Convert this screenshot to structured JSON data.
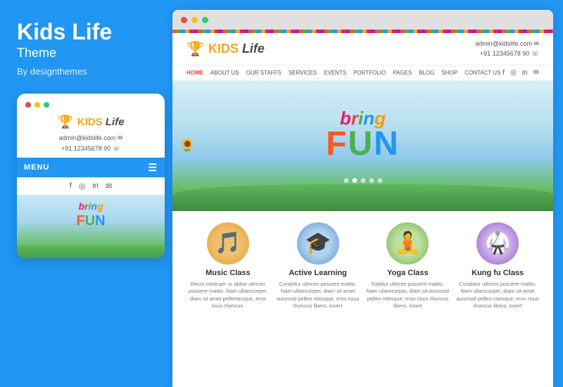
{
  "left": {
    "title": "Kids Life",
    "subtitle": "Theme",
    "author": "By designthemes",
    "dots": [
      "dot-red",
      "dot-yellow",
      "dot-green"
    ],
    "logo": {
      "trophy": "🏆",
      "kids": "KIDS",
      "life": "Life"
    },
    "contact": {
      "email": "admin@kidslife.com",
      "phone": "+91 12345678 90"
    },
    "menu_label": "MENU",
    "social_icons": [
      "f",
      "◎",
      "in",
      "✉"
    ],
    "bring_text": "bring",
    "fun_text": "FUN",
    "bring_letters": [
      "b",
      "r",
      "i",
      "n",
      "g"
    ],
    "fun_letters": [
      "F",
      "U",
      "N"
    ]
  },
  "browser": {
    "dots": [
      {
        "class": "dot-red",
        "color": "#e74c3c"
      },
      {
        "class": "dot-yellow",
        "color": "#f1c40f"
      },
      {
        "class": "dot-green",
        "color": "#2ecc71"
      }
    ],
    "header": {
      "trophy": "🏆",
      "kids": "KIDS",
      "life": "Life",
      "email": "admin@kidslife.com ✉",
      "phone": "+91 12345678 90 ☏"
    },
    "nav": {
      "links": [
        "HOME",
        "ABOUT US",
        "OUR STAFFS",
        "SERVICES",
        "EVENTS",
        "PORTFOLIO",
        "PAGES",
        "BLOG",
        "SHOP",
        "CONTACT US"
      ],
      "active_index": 0
    },
    "hero": {
      "bring": "bring",
      "fun": "FUN",
      "bring_letters": [
        "b",
        "r",
        "i",
        "n",
        "g"
      ],
      "fun_letters": [
        "F",
        "U",
        "N"
      ]
    },
    "classes": [
      {
        "name": "Music Class",
        "emoji": "🎵",
        "desc": "Decor ostdcaer ur abitur ultrices posuere mattis. Nam ullamcorper, diam sit amet pellentesque, eros risus rhoncus.",
        "avatar_class": "avatar-music"
      },
      {
        "name": "Active Learning",
        "emoji": "🎓",
        "desc": "Curabitur ultrices posuere mattis. Nam ullamcorper, diam sit amet auismod pelleo ntiesque, eros risus rhoncus libero, invert",
        "avatar_class": "avatar-learning"
      },
      {
        "name": "Yoga Class",
        "emoji": "🧘",
        "desc": "Rabitut ultrices posuere mattis. Nam ullamcorper, diam sit auismod pelleo ntiesque, eros risus rhoncus libero, invert",
        "avatar_class": "avatar-yoga"
      },
      {
        "name": "Kung fu Class",
        "emoji": "🥋",
        "desc": "Curabitur ultrices posuere mattis. Nam ullamcorper, diam sit amet auismod pelleo ntiesque, eros risus rhoncus libero, invert",
        "avatar_class": "avatar-kungfu"
      }
    ]
  }
}
